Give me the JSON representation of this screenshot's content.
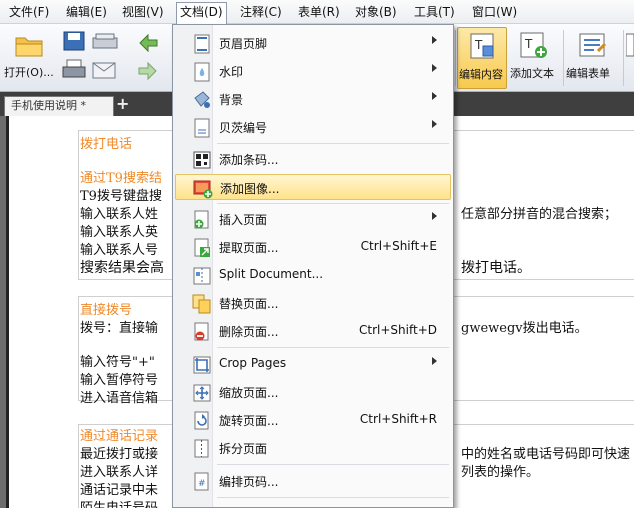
{
  "menubar": {
    "items": [
      "文件(F)",
      "编辑(E)",
      "视图(V)",
      "文档(D)",
      "注释(C)",
      "表单(R)",
      "对象(B)",
      "工具(T)",
      "窗口(W)"
    ],
    "active_index": 3
  },
  "toolbar": {
    "open_label": "打开(O)...",
    "edit_content_label": "编辑内容",
    "add_text_label": "添加文本",
    "edit_form_label": "编辑表单"
  },
  "tab": {
    "title": "手机使用说明 *",
    "new_tab": "+"
  },
  "document": {
    "lines": [
      "拨打电话",
      "通过T9搜索结",
      "T9拨号键盘搜",
      "输入联系人姓",
      "输入联系人英",
      "输入联系人号",
      "搜索结果会高",
      "直接拨号",
      "拨号：直接输",
      "输入符号\"+\"",
      "输入暂停符号",
      "进入语音信箱",
      "通过通话记录",
      "最近拨打或接",
      "进入联系人详",
      "通话记录中未",
      "陌生电话号码"
    ],
    "right_fragments": [
      "任意部分拼音的混合搜索；",
      "拨打电话。",
      "gwewegv拨出电话。",
      "中的姓名或电话号码即可快速",
      "列表的操作。"
    ]
  },
  "dropdown": {
    "items": [
      {
        "label": "页眉页脚",
        "shortcut": "",
        "submenu": true,
        "icon": "header-footer-icon"
      },
      {
        "label": "水印",
        "shortcut": "",
        "submenu": true,
        "icon": "watermark-icon"
      },
      {
        "label": "背景",
        "shortcut": "",
        "submenu": true,
        "icon": "background-icon"
      },
      {
        "label": "贝茨编号",
        "shortcut": "",
        "submenu": true,
        "icon": "bates-number-icon"
      },
      {
        "label": "添加条码...",
        "shortcut": "",
        "submenu": false,
        "icon": "barcode-icon"
      },
      {
        "label": "添加图像...",
        "shortcut": "",
        "submenu": false,
        "icon": "add-image-icon"
      },
      {
        "label": "插入页面",
        "shortcut": "",
        "submenu": true,
        "icon": "insert-page-icon"
      },
      {
        "label": "提取页面...",
        "shortcut": "Ctrl+Shift+E",
        "submenu": false,
        "icon": "extract-page-icon"
      },
      {
        "label": "Split Document...",
        "shortcut": "",
        "submenu": false,
        "icon": "split-document-icon"
      },
      {
        "label": "替换页面...",
        "shortcut": "",
        "submenu": false,
        "icon": "replace-page-icon"
      },
      {
        "label": "删除页面...",
        "shortcut": "Ctrl+Shift+D",
        "submenu": false,
        "icon": "delete-page-icon"
      },
      {
        "label": "Crop Pages",
        "shortcut": "",
        "submenu": true,
        "icon": "crop-pages-icon"
      },
      {
        "label": "缩放页面...",
        "shortcut": "",
        "submenu": false,
        "icon": "resize-page-icon"
      },
      {
        "label": "旋转页面...",
        "shortcut": "Ctrl+Shift+R",
        "submenu": false,
        "icon": "rotate-page-icon"
      },
      {
        "label": "拆分页面",
        "shortcut": "",
        "submenu": false,
        "icon": "split-page-icon"
      },
      {
        "label": "编排页码...",
        "shortcut": "",
        "submenu": false,
        "icon": "page-numbering-icon"
      }
    ],
    "highlighted_index": 5
  }
}
